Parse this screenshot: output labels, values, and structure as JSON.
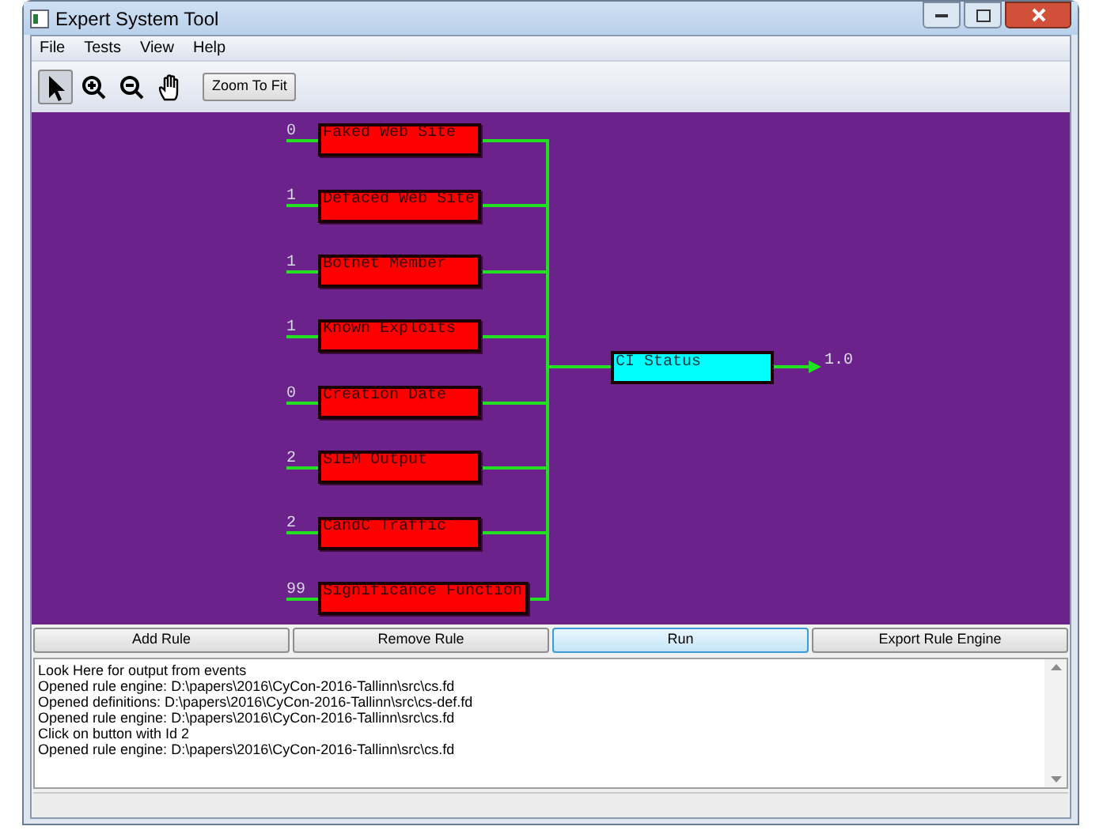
{
  "window": {
    "title": "Expert System Tool"
  },
  "menu": [
    "File",
    "Tests",
    "View",
    "Help"
  ],
  "toolbar": {
    "tools": [
      {
        "kind": "pointer",
        "selected": true
      },
      {
        "kind": "zoom-in",
        "selected": false
      },
      {
        "kind": "zoom-out",
        "selected": false
      },
      {
        "kind": "pan",
        "selected": false
      }
    ],
    "zoom_button": "Zoom To Fit"
  },
  "rules": [
    {
      "label": "Faked Web Site",
      "input": "0"
    },
    {
      "label": "Defaced Web Site",
      "input": "1"
    },
    {
      "label": "Botnet Member",
      "input": "1"
    },
    {
      "label": "Known Exploits",
      "input": "1"
    },
    {
      "label": "Creation Date",
      "input": "0"
    },
    {
      "label": "SIEM Output",
      "input": "2"
    },
    {
      "label": "CandC Traffic",
      "input": "2"
    },
    {
      "label": "Significance Function",
      "input": "99"
    }
  ],
  "output": {
    "label": "CI Status",
    "value": "1.0"
  },
  "buttons": [
    {
      "label": "Add Rule",
      "focused": false
    },
    {
      "label": "Remove Rule",
      "focused": false
    },
    {
      "label": "Run",
      "focused": true
    },
    {
      "label": "Export Rule Engine",
      "focused": false
    }
  ],
  "log": [
    "Look Here for output from events",
    "Opened rule engine: D:\\papers\\2016\\CyCon-2016-Tallinn\\src\\cs.fd",
    "Opened definitions: D:\\papers\\2016\\CyCon-2016-Tallinn\\src\\cs-def.fd",
    "Opened rule engine: D:\\papers\\2016\\CyCon-2016-Tallinn\\src\\cs.fd",
    "Click on button with Id 2",
    "Opened rule engine: D:\\papers\\2016\\CyCon-2016-Tallinn\\src\\cs.fd"
  ]
}
